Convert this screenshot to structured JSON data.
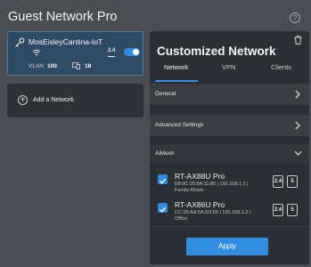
{
  "app": {
    "title": "Guest Network Pro"
  },
  "network_card": {
    "ssid": "MosEisleyCantina-IoT",
    "band": "2.4",
    "enabled": true,
    "vlan_label": "VLAN",
    "vlan_value": "100",
    "device_count": "18"
  },
  "add_network": {
    "label": "Add a Network"
  },
  "panel": {
    "title": "Customized Network",
    "tabs": [
      {
        "label": "Network",
        "active": true
      },
      {
        "label": "VPN",
        "active": false
      },
      {
        "label": "Clients",
        "active": false
      }
    ],
    "sections": {
      "general": "General",
      "advanced": "Advanced Settings",
      "aimesh": "AiMesh"
    },
    "nodes": [
      {
        "name": "RT-AX88U Pro",
        "detail_line1": "E8:9C:25:8A:11:80 | 192.168.1.1 |",
        "detail_line2": "Family Room",
        "checked": true,
        "bands": [
          "2.4",
          "5"
        ]
      },
      {
        "name": "RT-AX86U Pro",
        "detail_line1": "CC:28:AA:5A:D3:50 | 192.168.1.2 |",
        "detail_line2": "Office",
        "checked": true,
        "bands": [
          "2.4",
          "5"
        ]
      }
    ],
    "apply_label": "Apply"
  },
  "colors": {
    "background": "#4a4d52",
    "panel": "#2b2f33",
    "card_selected": "#2f4b63",
    "accent": "#2f8cdf"
  }
}
